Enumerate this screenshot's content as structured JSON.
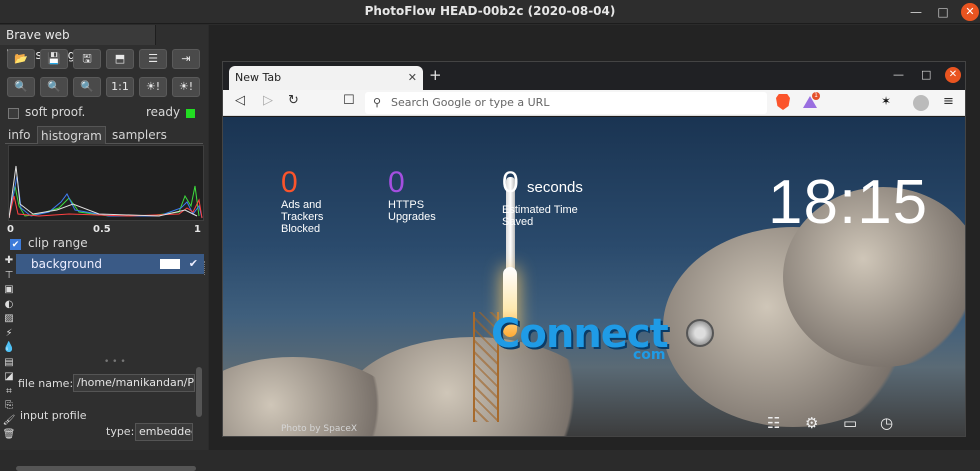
{
  "window": {
    "title": "PhotoFlow HEAD-00b2c (2020-08-04)",
    "min_icon": "minimize-icon",
    "max_icon": "maximize-icon",
    "close_icon": "close-icon"
  },
  "left_panel": {
    "file_tab": {
      "label": "Brave web browser.jpg",
      "close": "✕"
    },
    "toolbar_row1": [
      {
        "name": "open-folder-icon",
        "glyph": "📂"
      },
      {
        "name": "save-icon",
        "glyph": "💾"
      },
      {
        "name": "save-as-icon",
        "glyph": "🖫"
      },
      {
        "name": "export-icon",
        "glyph": "⬒"
      },
      {
        "name": "settings-sliders-icon",
        "glyph": "☰"
      },
      {
        "name": "exit-icon",
        "glyph": "⇥"
      }
    ],
    "toolbar_row2": [
      {
        "name": "zoom-in-icon",
        "glyph": "🔍"
      },
      {
        "name": "zoom-out-icon",
        "glyph": "🔍"
      },
      {
        "name": "zoom-fit-icon",
        "glyph": "🔍"
      },
      {
        "name": "zoom-100-label",
        "glyph": "1:1"
      },
      {
        "name": "shadows-clip-icon",
        "glyph": "☀!"
      },
      {
        "name": "highlights-clip-icon",
        "glyph": "☀!"
      }
    ],
    "soft_proof_label": "soft proof.",
    "status_label": "ready",
    "tabs": [
      {
        "label": "info",
        "active": false
      },
      {
        "label": "histogram",
        "active": true
      },
      {
        "label": "samplers",
        "active": false
      }
    ],
    "histogram_scale": [
      "0",
      "0.5",
      "1"
    ],
    "clip_range_label": "clip range",
    "layer_row_label": "background",
    "layer_check": "✔",
    "file_name_label": "file name:",
    "file_name_value": "/home/manikandan/P",
    "input_profile_label": "input profile",
    "type_label": "type:",
    "type_value": "embedded",
    "tool_icons": [
      "plus-icon",
      "group-icon",
      "image-icon",
      "contrast-icon",
      "landscape-icon",
      "flash-icon",
      "drop-icon",
      "gradient-icon",
      "crop-icon",
      "transform-icon",
      "clone-icon",
      "brush-icon",
      "trash-icon"
    ],
    "tool_glyphs": [
      "✚",
      "⊤",
      "▣",
      "◐",
      "▨",
      "⚡",
      "💧",
      "▤",
      "◪",
      "⌗",
      "⎘",
      "🖌",
      "🗑"
    ]
  },
  "browser": {
    "tab_title": "New Tab",
    "tab_close": "✕",
    "new_tab": "+",
    "win_min": "—",
    "win_max": "□",
    "win_close": "✕",
    "nav_back": "◁",
    "nav_forward": "▷",
    "nav_reload": "↻",
    "bookmark": "☐",
    "url_placeholder": "Search Google or type a URL",
    "rewards_badge": "1",
    "menu": "≡",
    "accent_brave": "#fb542b",
    "stats": [
      {
        "num": "0",
        "label": "Ads and Trackers Blocked",
        "color": "#fb542b"
      },
      {
        "num": "0",
        "label": "HTTPS Upgrades",
        "color": "#a44fe0"
      },
      {
        "num": "0",
        "unit": "seconds",
        "label": "Estimated Time Saved",
        "color": "#ffffff"
      }
    ],
    "clock": "18:15",
    "photo_credit": "Photo by SpaceX",
    "page_icons": [
      "customize-icon",
      "settings-icon",
      "bookmarks-icon",
      "history-icon"
    ]
  },
  "watermark": {
    "big": "Connect",
    "small": "com"
  }
}
